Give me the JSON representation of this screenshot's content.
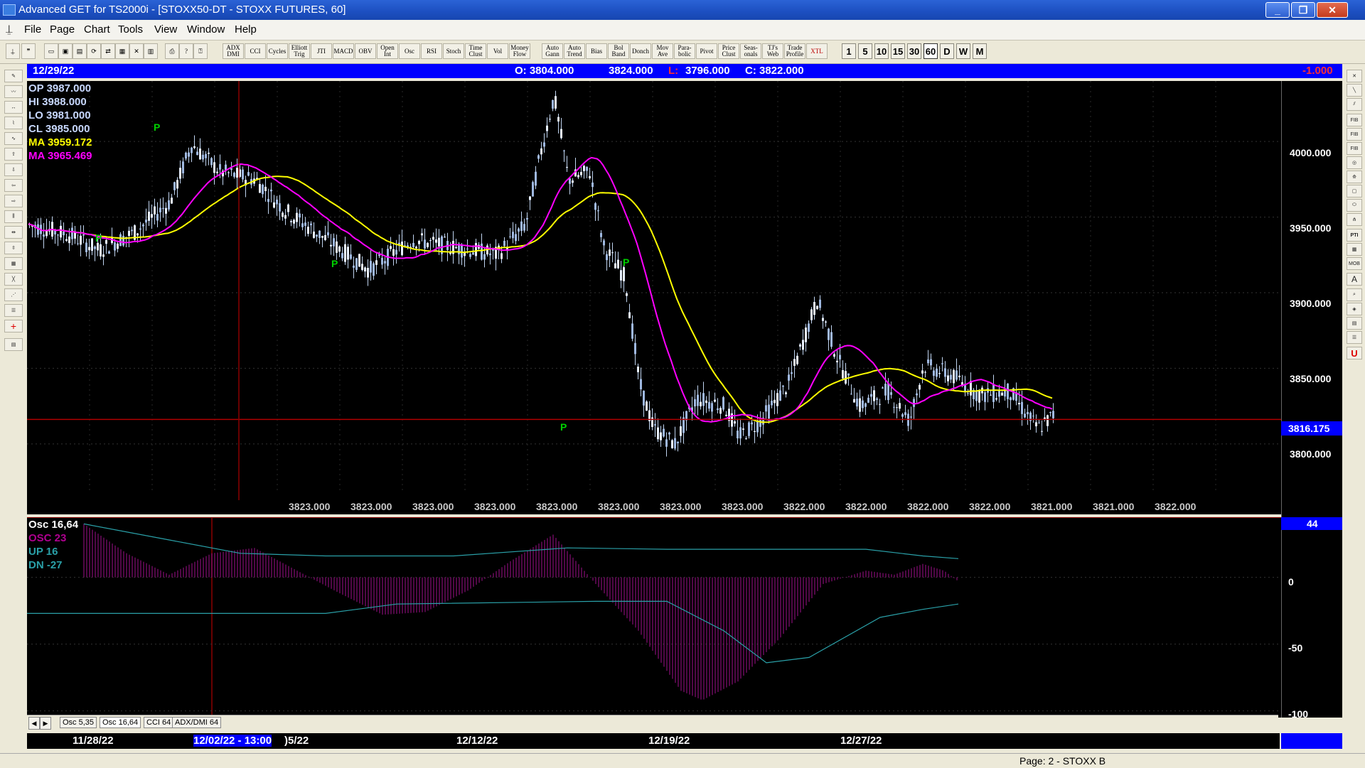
{
  "window": {
    "title": "Advanced GET for TS2000i - [STOXX50-DT - STOXX FUTURES, 60]"
  },
  "menu": {
    "items": [
      "File",
      "Page",
      "Chart",
      "Tools",
      "View",
      "Window",
      "Help"
    ]
  },
  "toolbar": {
    "indicator_buttons": [
      "ADX DMI",
      "CCI",
      "Cycles",
      "Elliott Trig",
      "JTI",
      "MACD",
      "OBV",
      "Open Int",
      "Osc",
      "RSI",
      "Stoch",
      "Time Clust",
      "Vol",
      "Money Flow",
      "Auto Gann",
      "Auto Trend",
      "Bias",
      "Bol Band",
      "Donch",
      "Mov Ave",
      "Para-bolic",
      "Pivot",
      "Price Clust",
      "Seas-onals",
      "TJ's Web",
      "Trade Profile",
      "XTL"
    ],
    "timeframes": [
      "1",
      "5",
      "10",
      "15",
      "30",
      "60",
      "D",
      "W",
      "M"
    ],
    "active_timeframe": "60"
  },
  "header": {
    "date": "12/29/22",
    "open": "O: 3804.000",
    "high": "3824.000",
    "low_label": "L:",
    "low": "3796.000",
    "close": "C: 3822.000",
    "change": "-1.000"
  },
  "legend": {
    "op": "OP  3987.000",
    "hi": "HI   3988.000",
    "lo": "LO  3981.000",
    "cl": "CL  3985.000",
    "ma1": "MA  3959.172",
    "ma2": "MA  3965.469",
    "colors": {
      "text": "#c8d8ff",
      "ma1": "#ffff00",
      "ma2": "#ff00ff"
    }
  },
  "price_axis": {
    "labels": [
      "4000.000",
      "3950.000",
      "3900.000",
      "3850.000",
      "3800.000"
    ],
    "current": "3816.175"
  },
  "xtl_values": [
    "3823.000",
    "3823.000",
    "3823.000",
    "3823.000",
    "3823.000",
    "3823.000",
    "3823.000",
    "3823.000",
    "3822.000",
    "3822.000",
    "3822.000",
    "3822.000",
    "3821.000",
    "3821.000",
    "3822.000"
  ],
  "pivot_marker": "P",
  "osc": {
    "title": "Osc 16,64",
    "osc": "OSC 23",
    "up": "UP   16",
    "dn": "DN   -27",
    "value_badge": "44",
    "axis_labels": [
      "0",
      "-50",
      "-100"
    ]
  },
  "tabs": {
    "items": [
      "Osc 5,35",
      "Osc 16,64",
      "CCI 64",
      "ADX/DMI 64"
    ],
    "active": "Osc 16,64"
  },
  "datebar": {
    "labels": [
      "11/28/22",
      "12/02/22 - 13:00",
      ")5/22",
      "12/12/22",
      "12/19/22",
      "12/27/22"
    ]
  },
  "status": {
    "page": "Page: 2 - STOXX B"
  },
  "chart_data": {
    "type": "line",
    "price_range": [
      3760,
      4040
    ],
    "current_price": 3816.175,
    "last_close": 3822.0,
    "osc_range": [
      -105,
      45
    ],
    "osc_value": 23,
    "osc_up": 16,
    "osc_dn": -27
  }
}
